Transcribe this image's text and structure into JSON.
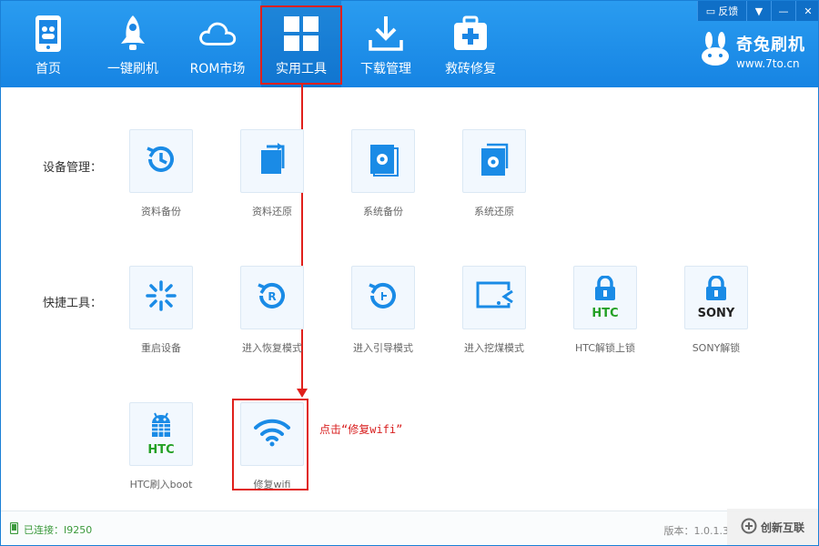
{
  "nav": {
    "items": [
      {
        "label": "首页",
        "icon": "phone-icon"
      },
      {
        "label": "一键刷机",
        "icon": "rocket-icon"
      },
      {
        "label": "ROM市场",
        "icon": "cloud-icon"
      },
      {
        "label": "实用工具",
        "icon": "grid-icon"
      },
      {
        "label": "下载管理",
        "icon": "download-icon"
      },
      {
        "label": "救砖修复",
        "icon": "medkit-icon"
      }
    ]
  },
  "window": {
    "feedback_label": "反馈"
  },
  "brand": {
    "name": "奇兔刷机",
    "url": "www.7to.cn"
  },
  "sections": {
    "device": "设备管理：",
    "quick": "快捷工具："
  },
  "tools": {
    "device": [
      "资料备份",
      "资料还原",
      "系统备份",
      "系统还原"
    ],
    "quick": [
      "重启设备",
      "进入恢复模式",
      "进入引导模式",
      "进入挖煤模式",
      "HTC解锁上锁",
      "SONY解锁"
    ],
    "extra": [
      "HTC刷入boot",
      "修复wifi"
    ]
  },
  "badges": {
    "htc": "HTC",
    "sony": "SONY",
    "restore": "R"
  },
  "annotation": "点击“修复wifi”",
  "status": {
    "connected": "已连接：I9250",
    "version": "版本：1.0.1.3"
  },
  "watermark": "创新互联",
  "colors": {
    "accent": "#1684e3",
    "highlight": "#e0201b",
    "icon": "#1a8be6",
    "status_green": "#3c9a3c"
  }
}
